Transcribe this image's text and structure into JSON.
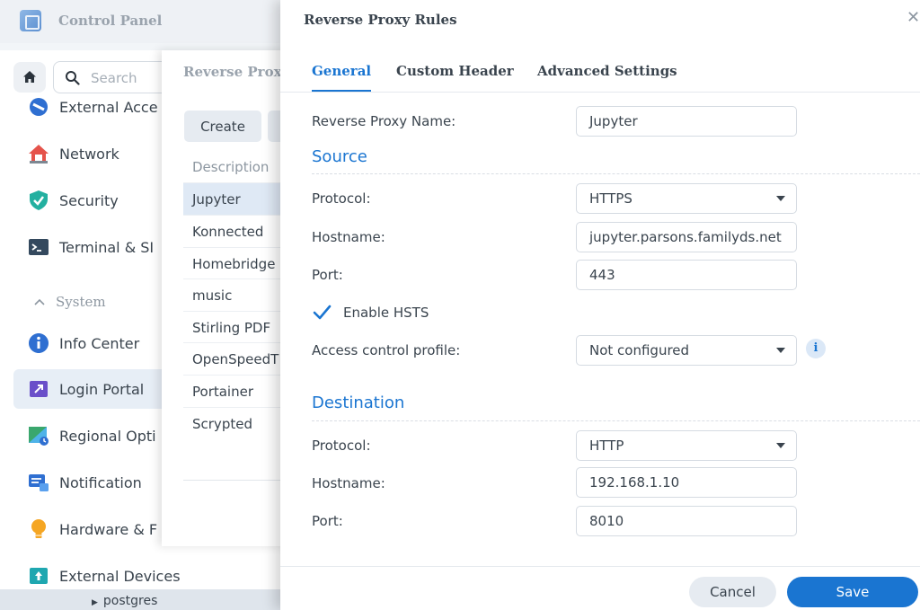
{
  "control_panel": {
    "title": "Control Panel",
    "search_placeholder": "Search",
    "items": [
      {
        "label": "External Acce",
        "icon": "external-access-icon"
      },
      {
        "label": "Network",
        "icon": "network-house-icon"
      },
      {
        "label": "Security",
        "icon": "shield-check-icon"
      },
      {
        "label": "Terminal & SI",
        "icon": "terminal-icon"
      },
      {
        "label": "Info Center",
        "icon": "info-icon"
      },
      {
        "label": "Login Portal",
        "icon": "login-portal-icon"
      },
      {
        "label": "Regional Opti",
        "icon": "regional-options-icon"
      },
      {
        "label": "Notification",
        "icon": "notification-icon"
      },
      {
        "label": "Hardware & F",
        "icon": "lightbulb-icon"
      },
      {
        "label": "External Devices",
        "icon": "external-devices-icon"
      }
    ],
    "section_system": "System",
    "tree_item": "postgres"
  },
  "reverse_proxy_list": {
    "title": "Reverse Prox",
    "create_label": "Create",
    "column_header": "Description",
    "rows": [
      "Jupyter",
      "Konnected",
      "Homebridge",
      "music",
      "Stirling PDF",
      "OpenSpeedT",
      "Portainer",
      "Scrypted"
    ],
    "selected_index": 0
  },
  "dialog": {
    "title": "Reverse Proxy Rules",
    "tabs": [
      "General",
      "Custom Header",
      "Advanced Settings"
    ],
    "active_tab": "General",
    "name_label": "Reverse Proxy Name:",
    "name_value": "Jupyter",
    "source": {
      "title": "Source",
      "protocol_label": "Protocol:",
      "protocol_value": "HTTPS",
      "hostname_label": "Hostname:",
      "hostname_value": "jupyter.parsons.familyds.net",
      "port_label": "Port:",
      "port_value": "443",
      "hsts_label": "Enable HSTS",
      "hsts_checked": true,
      "access_label": "Access control profile:",
      "access_value": "Not configured"
    },
    "destination": {
      "title": "Destination",
      "protocol_label": "Protocol:",
      "protocol_value": "HTTP",
      "hostname_label": "Hostname:",
      "hostname_value": "192.168.1.10",
      "port_label": "Port:",
      "port_value": "8010"
    },
    "cancel_label": "Cancel",
    "save_label": "Save"
  },
  "colors": {
    "accent": "#1a75d1",
    "text": "#3a444e",
    "muted": "#9aa3ad"
  }
}
